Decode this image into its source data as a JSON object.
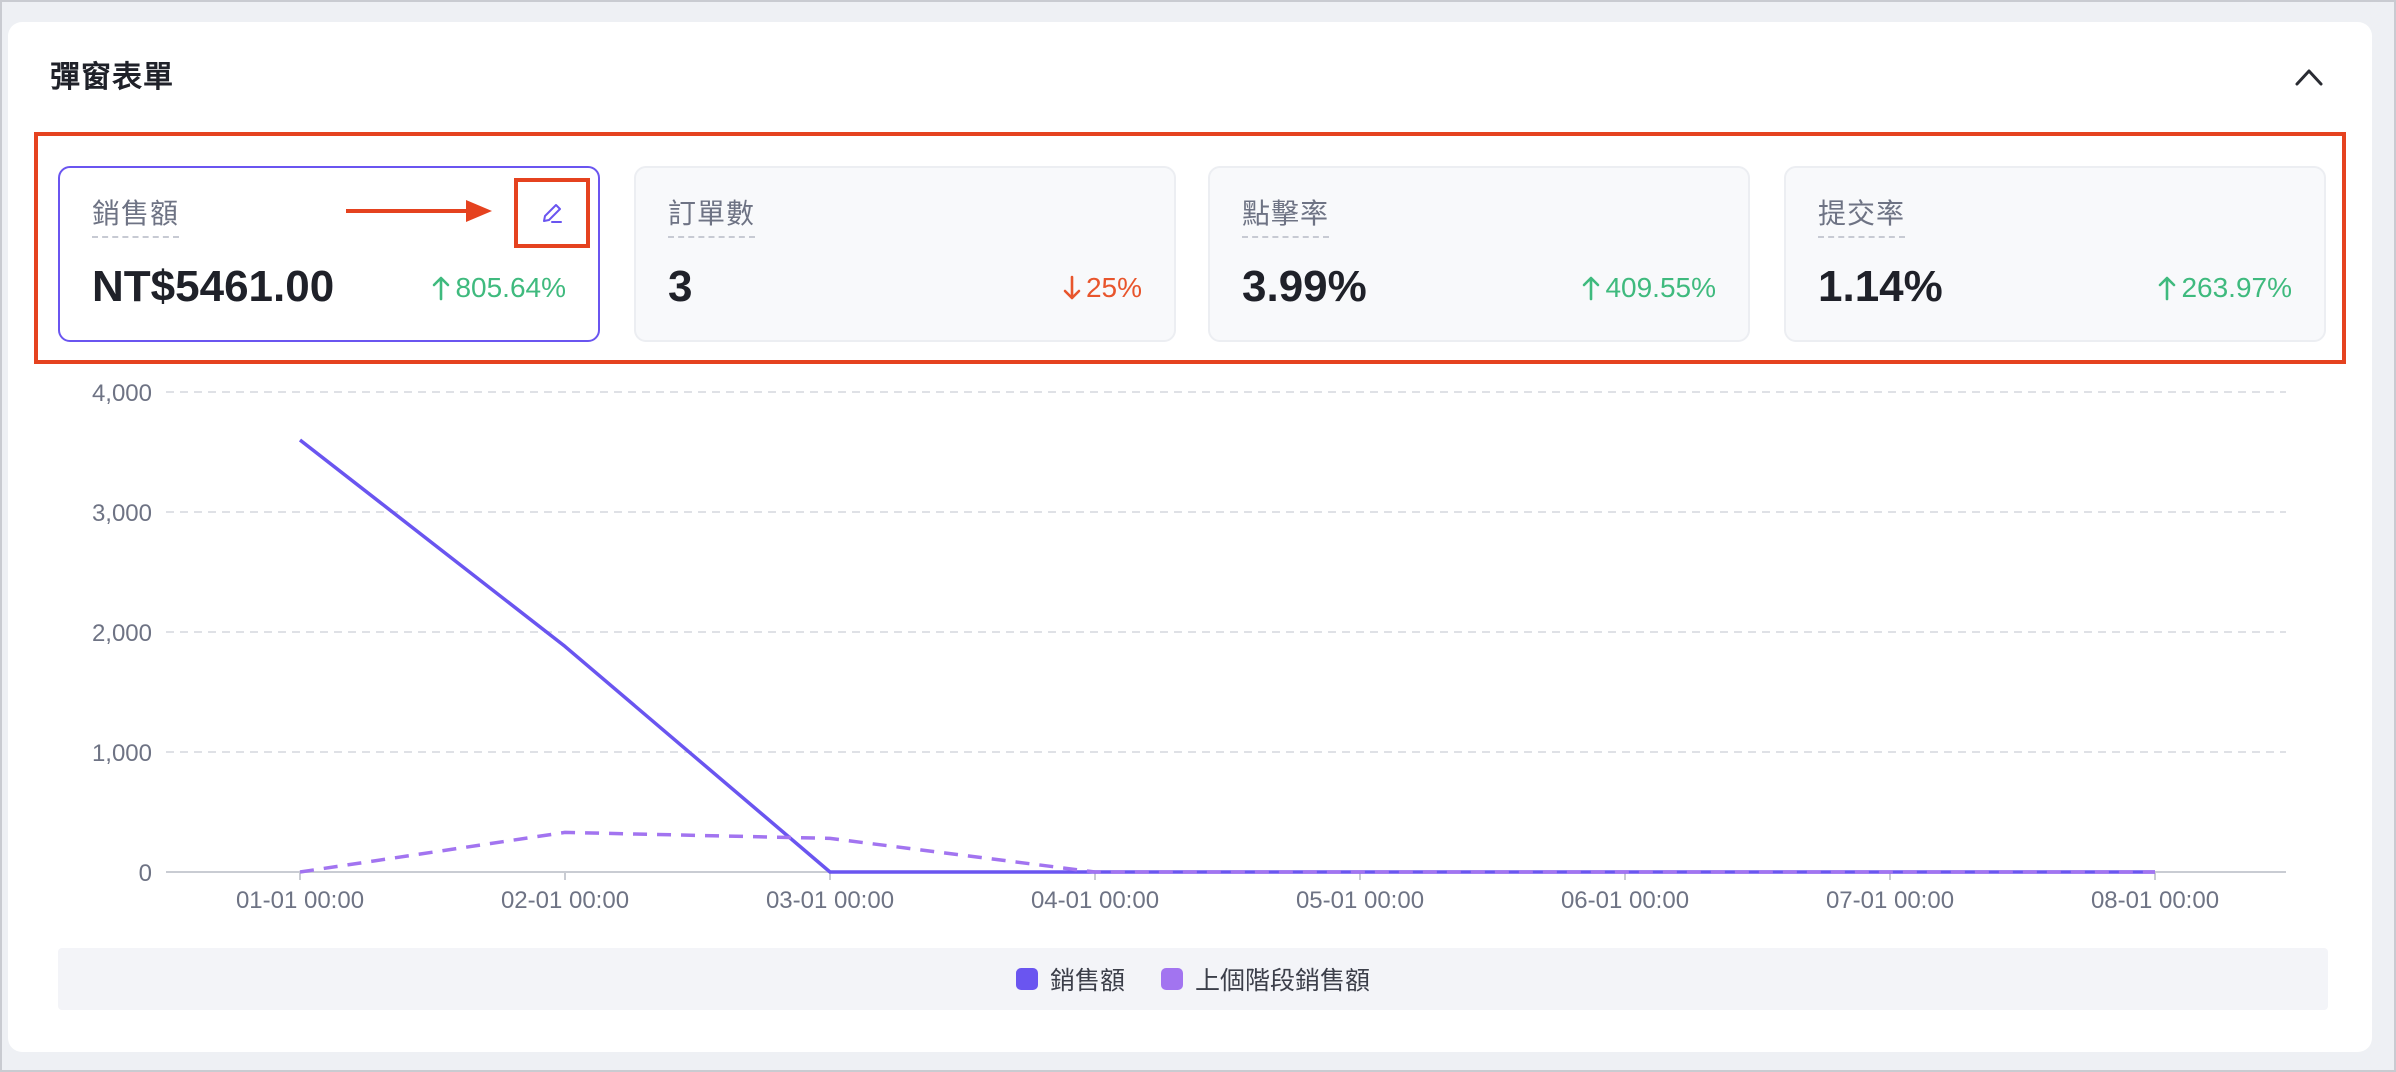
{
  "panel": {
    "title": "彈窗表單",
    "collapse_icon": "chevron-up-icon"
  },
  "metrics": [
    {
      "label": "銷售額",
      "value": "NT$5461.00",
      "change": "805.64%",
      "direction": "up",
      "active": true
    },
    {
      "label": "訂單數",
      "value": "3",
      "change": "25%",
      "direction": "down",
      "active": false
    },
    {
      "label": "點擊率",
      "value": "3.99%",
      "change": "409.55%",
      "direction": "up",
      "active": false
    },
    {
      "label": "提交率",
      "value": "1.14%",
      "change": "263.97%",
      "direction": "up",
      "active": false
    }
  ],
  "edit_icon": "pencil-icon",
  "colors": {
    "up": "#3fba7e",
    "down": "#e8552c",
    "primary": "#6a55f0",
    "secondary": "#a274f0",
    "annotation": "#e5421f"
  },
  "chart_data": {
    "type": "line",
    "categories": [
      "01-01 00:00",
      "02-01 00:00",
      "03-01 00:00",
      "04-01 00:00",
      "05-01 00:00",
      "06-01 00:00",
      "07-01 00:00",
      "08-01 00:00"
    ],
    "series": [
      {
        "name": "銷售額",
        "values": [
          3600,
          1880,
          0,
          0,
          0,
          0,
          0,
          0
        ],
        "color": "#6a55f0",
        "dashed": false
      },
      {
        "name": "上個階段銷售額",
        "values": [
          0,
          330,
          280,
          0,
          0,
          0,
          0,
          0
        ],
        "color": "#a274f0",
        "dashed": true
      }
    ],
    "yticks": [
      "0",
      "1,000",
      "2,000",
      "3,000",
      "4,000"
    ],
    "ylim": [
      0,
      4000
    ],
    "grid": true,
    "legend": "bottom-center"
  }
}
